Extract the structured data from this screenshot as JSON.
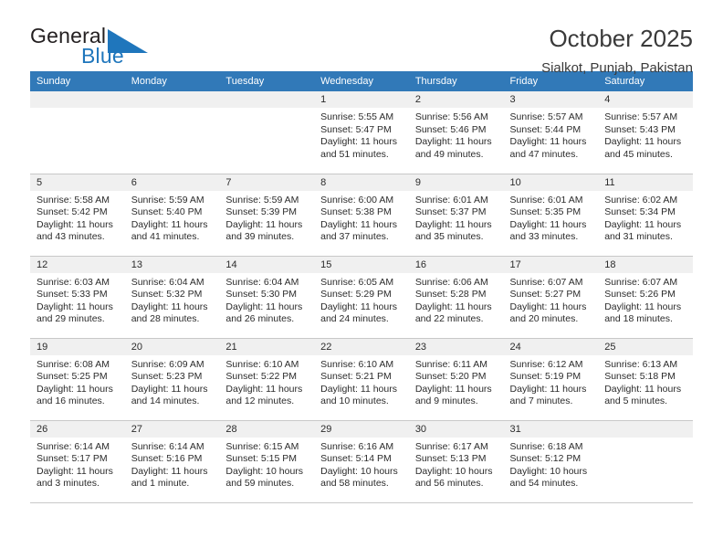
{
  "brand": {
    "name_part1": "General",
    "name_part2": "Blue",
    "triangle_icon": "brand-triangle-icon",
    "accent_color": "#1f76bc"
  },
  "header": {
    "title": "October 2025",
    "subtitle": "Sialkot, Punjab, Pakistan"
  },
  "calendar": {
    "header_color": "#3179b8",
    "weekday_headers": [
      "Sunday",
      "Monday",
      "Tuesday",
      "Wednesday",
      "Thursday",
      "Friday",
      "Saturday"
    ],
    "weeks": [
      [
        {
          "day": "",
          "sunrise": "",
          "sunset": "",
          "daylight_line1": "",
          "daylight_line2": "",
          "blank": true
        },
        {
          "day": "",
          "sunrise": "",
          "sunset": "",
          "daylight_line1": "",
          "daylight_line2": "",
          "blank": true
        },
        {
          "day": "",
          "sunrise": "",
          "sunset": "",
          "daylight_line1": "",
          "daylight_line2": "",
          "blank": true
        },
        {
          "day": "1",
          "sunrise": "Sunrise: 5:55 AM",
          "sunset": "Sunset: 5:47 PM",
          "daylight_line1": "Daylight: 11 hours",
          "daylight_line2": "and 51 minutes."
        },
        {
          "day": "2",
          "sunrise": "Sunrise: 5:56 AM",
          "sunset": "Sunset: 5:46 PM",
          "daylight_line1": "Daylight: 11 hours",
          "daylight_line2": "and 49 minutes."
        },
        {
          "day": "3",
          "sunrise": "Sunrise: 5:57 AM",
          "sunset": "Sunset: 5:44 PM",
          "daylight_line1": "Daylight: 11 hours",
          "daylight_line2": "and 47 minutes."
        },
        {
          "day": "4",
          "sunrise": "Sunrise: 5:57 AM",
          "sunset": "Sunset: 5:43 PM",
          "daylight_line1": "Daylight: 11 hours",
          "daylight_line2": "and 45 minutes."
        }
      ],
      [
        {
          "day": "5",
          "sunrise": "Sunrise: 5:58 AM",
          "sunset": "Sunset: 5:42 PM",
          "daylight_line1": "Daylight: 11 hours",
          "daylight_line2": "and 43 minutes."
        },
        {
          "day": "6",
          "sunrise": "Sunrise: 5:59 AM",
          "sunset": "Sunset: 5:40 PM",
          "daylight_line1": "Daylight: 11 hours",
          "daylight_line2": "and 41 minutes."
        },
        {
          "day": "7",
          "sunrise": "Sunrise: 5:59 AM",
          "sunset": "Sunset: 5:39 PM",
          "daylight_line1": "Daylight: 11 hours",
          "daylight_line2": "and 39 minutes."
        },
        {
          "day": "8",
          "sunrise": "Sunrise: 6:00 AM",
          "sunset": "Sunset: 5:38 PM",
          "daylight_line1": "Daylight: 11 hours",
          "daylight_line2": "and 37 minutes."
        },
        {
          "day": "9",
          "sunrise": "Sunrise: 6:01 AM",
          "sunset": "Sunset: 5:37 PM",
          "daylight_line1": "Daylight: 11 hours",
          "daylight_line2": "and 35 minutes."
        },
        {
          "day": "10",
          "sunrise": "Sunrise: 6:01 AM",
          "sunset": "Sunset: 5:35 PM",
          "daylight_line1": "Daylight: 11 hours",
          "daylight_line2": "and 33 minutes."
        },
        {
          "day": "11",
          "sunrise": "Sunrise: 6:02 AM",
          "sunset": "Sunset: 5:34 PM",
          "daylight_line1": "Daylight: 11 hours",
          "daylight_line2": "and 31 minutes."
        }
      ],
      [
        {
          "day": "12",
          "sunrise": "Sunrise: 6:03 AM",
          "sunset": "Sunset: 5:33 PM",
          "daylight_line1": "Daylight: 11 hours",
          "daylight_line2": "and 29 minutes."
        },
        {
          "day": "13",
          "sunrise": "Sunrise: 6:04 AM",
          "sunset": "Sunset: 5:32 PM",
          "daylight_line1": "Daylight: 11 hours",
          "daylight_line2": "and 28 minutes."
        },
        {
          "day": "14",
          "sunrise": "Sunrise: 6:04 AM",
          "sunset": "Sunset: 5:30 PM",
          "daylight_line1": "Daylight: 11 hours",
          "daylight_line2": "and 26 minutes."
        },
        {
          "day": "15",
          "sunrise": "Sunrise: 6:05 AM",
          "sunset": "Sunset: 5:29 PM",
          "daylight_line1": "Daylight: 11 hours",
          "daylight_line2": "and 24 minutes."
        },
        {
          "day": "16",
          "sunrise": "Sunrise: 6:06 AM",
          "sunset": "Sunset: 5:28 PM",
          "daylight_line1": "Daylight: 11 hours",
          "daylight_line2": "and 22 minutes."
        },
        {
          "day": "17",
          "sunrise": "Sunrise: 6:07 AM",
          "sunset": "Sunset: 5:27 PM",
          "daylight_line1": "Daylight: 11 hours",
          "daylight_line2": "and 20 minutes."
        },
        {
          "day": "18",
          "sunrise": "Sunrise: 6:07 AM",
          "sunset": "Sunset: 5:26 PM",
          "daylight_line1": "Daylight: 11 hours",
          "daylight_line2": "and 18 minutes."
        }
      ],
      [
        {
          "day": "19",
          "sunrise": "Sunrise: 6:08 AM",
          "sunset": "Sunset: 5:25 PM",
          "daylight_line1": "Daylight: 11 hours",
          "daylight_line2": "and 16 minutes."
        },
        {
          "day": "20",
          "sunrise": "Sunrise: 6:09 AM",
          "sunset": "Sunset: 5:23 PM",
          "daylight_line1": "Daylight: 11 hours",
          "daylight_line2": "and 14 minutes."
        },
        {
          "day": "21",
          "sunrise": "Sunrise: 6:10 AM",
          "sunset": "Sunset: 5:22 PM",
          "daylight_line1": "Daylight: 11 hours",
          "daylight_line2": "and 12 minutes."
        },
        {
          "day": "22",
          "sunrise": "Sunrise: 6:10 AM",
          "sunset": "Sunset: 5:21 PM",
          "daylight_line1": "Daylight: 11 hours",
          "daylight_line2": "and 10 minutes."
        },
        {
          "day": "23",
          "sunrise": "Sunrise: 6:11 AM",
          "sunset": "Sunset: 5:20 PM",
          "daylight_line1": "Daylight: 11 hours",
          "daylight_line2": "and 9 minutes."
        },
        {
          "day": "24",
          "sunrise": "Sunrise: 6:12 AM",
          "sunset": "Sunset: 5:19 PM",
          "daylight_line1": "Daylight: 11 hours",
          "daylight_line2": "and 7 minutes."
        },
        {
          "day": "25",
          "sunrise": "Sunrise: 6:13 AM",
          "sunset": "Sunset: 5:18 PM",
          "daylight_line1": "Daylight: 11 hours",
          "daylight_line2": "and 5 minutes."
        }
      ],
      [
        {
          "day": "26",
          "sunrise": "Sunrise: 6:14 AM",
          "sunset": "Sunset: 5:17 PM",
          "daylight_line1": "Daylight: 11 hours",
          "daylight_line2": "and 3 minutes."
        },
        {
          "day": "27",
          "sunrise": "Sunrise: 6:14 AM",
          "sunset": "Sunset: 5:16 PM",
          "daylight_line1": "Daylight: 11 hours",
          "daylight_line2": "and 1 minute."
        },
        {
          "day": "28",
          "sunrise": "Sunrise: 6:15 AM",
          "sunset": "Sunset: 5:15 PM",
          "daylight_line1": "Daylight: 10 hours",
          "daylight_line2": "and 59 minutes."
        },
        {
          "day": "29",
          "sunrise": "Sunrise: 6:16 AM",
          "sunset": "Sunset: 5:14 PM",
          "daylight_line1": "Daylight: 10 hours",
          "daylight_line2": "and 58 minutes."
        },
        {
          "day": "30",
          "sunrise": "Sunrise: 6:17 AM",
          "sunset": "Sunset: 5:13 PM",
          "daylight_line1": "Daylight: 10 hours",
          "daylight_line2": "and 56 minutes."
        },
        {
          "day": "31",
          "sunrise": "Sunrise: 6:18 AM",
          "sunset": "Sunset: 5:12 PM",
          "daylight_line1": "Daylight: 10 hours",
          "daylight_line2": "and 54 minutes."
        },
        {
          "day": "",
          "sunrise": "",
          "sunset": "",
          "daylight_line1": "",
          "daylight_line2": "",
          "blank": true
        }
      ]
    ]
  }
}
